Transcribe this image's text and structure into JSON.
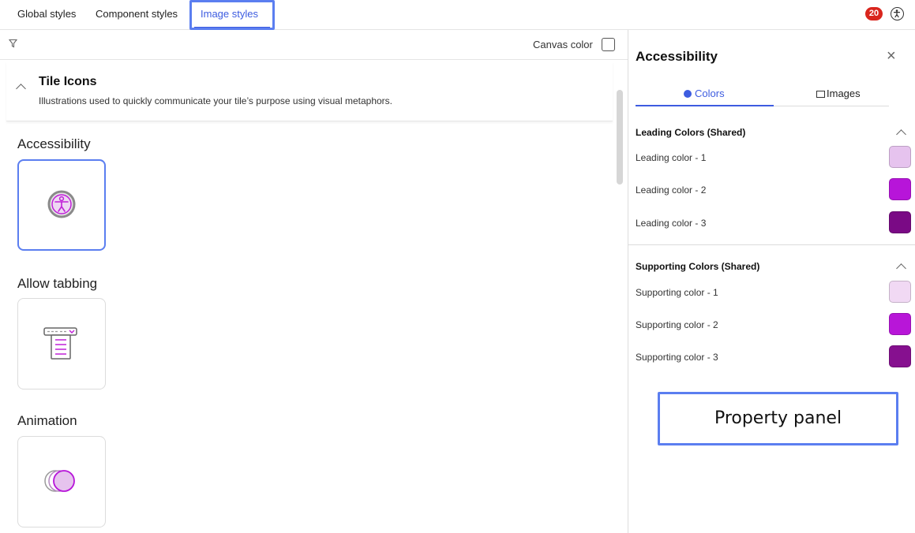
{
  "top_tabs": [
    {
      "label": "Global styles"
    },
    {
      "label": "Component styles"
    },
    {
      "label": "Image styles"
    }
  ],
  "notification_count": "20",
  "canvas": {
    "filter_icon": "filter-icon",
    "canvas_color_label": "Canvas color",
    "canvas_color_checked": false
  },
  "section": {
    "title": "Tile Icons",
    "description": "Illustrations used to quickly communicate your tile’s purpose using visual metaphors."
  },
  "items": [
    {
      "title": "Accessibility",
      "icon": "accessibility-icon",
      "selected": true
    },
    {
      "title": "Allow tabbing",
      "icon": "allow-tabbing-icon",
      "selected": false
    },
    {
      "title": "Animation",
      "icon": "animation-icon",
      "selected": false
    }
  ],
  "panel": {
    "title": "Accessibility",
    "tabs": [
      {
        "label": "Colors",
        "active": true
      },
      {
        "label": "Images",
        "active": false
      }
    ],
    "groups": [
      {
        "title": "Leading Colors (Shared)",
        "rows": [
          {
            "label": "Leading color - 1",
            "color": "#e6c3ee"
          },
          {
            "label": "Leading color - 2",
            "color": "#b715d9"
          },
          {
            "label": "Leading color - 3",
            "color": "#7a0a85"
          }
        ]
      },
      {
        "title": "Supporting Colors (Shared)",
        "rows": [
          {
            "label": "Supporting color - 1",
            "color": "#f1d9f4"
          },
          {
            "label": "Supporting color - 2",
            "color": "#b816d8"
          },
          {
            "label": "Supporting color - 3",
            "color": "#86108f"
          }
        ]
      }
    ],
    "annotation": "Property panel"
  },
  "colors": {
    "accent": "#3d5ce0",
    "annotation_border": "#5b7ef0",
    "badge": "#d9251d"
  }
}
